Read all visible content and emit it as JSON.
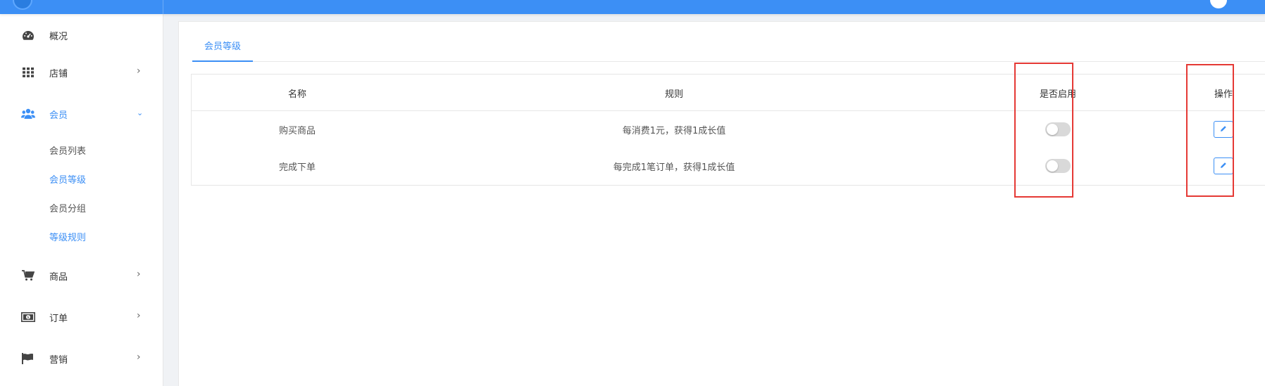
{
  "sidebar": {
    "items": [
      {
        "label": "概况",
        "icon": "dashboard-icon"
      },
      {
        "label": "店铺",
        "icon": "grid-icon"
      },
      {
        "label": "会员",
        "icon": "users-icon"
      },
      {
        "label": "商品",
        "icon": "cart-icon"
      },
      {
        "label": "订单",
        "icon": "money-icon"
      },
      {
        "label": "营销",
        "icon": "flag-icon"
      }
    ],
    "member_sub": [
      "会员列表",
      "会员等级",
      "会员分组",
      "等级规则"
    ]
  },
  "tabs": [
    {
      "label": "会员等级"
    }
  ],
  "table": {
    "columns": [
      "名称",
      "规则",
      "是否启用",
      "操作"
    ],
    "rows": [
      {
        "name": "购买商品",
        "rule": "每消费1元，获得1成长值",
        "enabled": false
      },
      {
        "name": "完成下单",
        "rule": "每完成1笔订单，获得1成长值",
        "enabled": false
      }
    ]
  },
  "colors": {
    "primary": "#3c8ff5",
    "highlight": "#e53935",
    "toggle_off": "#d9d9d9"
  }
}
